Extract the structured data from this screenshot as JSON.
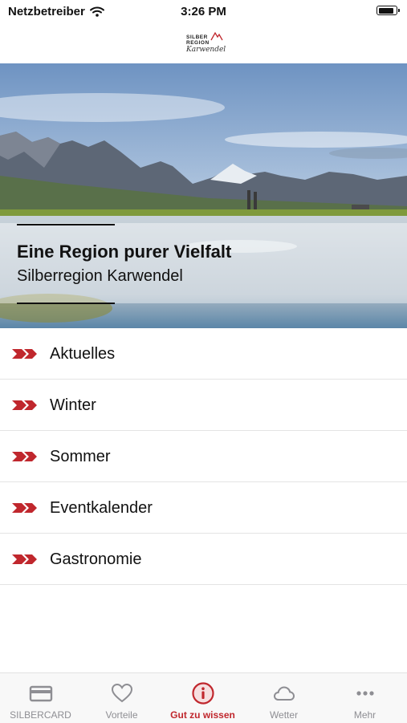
{
  "status_bar": {
    "carrier": "Netzbetreiber",
    "time": "3:26 PM",
    "battery_level": 0.9
  },
  "header": {
    "logo_line1": "SILBER",
    "logo_line2": "REGION",
    "logo_line3": "Karwendel"
  },
  "hero": {
    "title": "Eine Region purer Vielfalt",
    "subtitle": "Silberregion Karwendel"
  },
  "menu": {
    "items": [
      {
        "label": "Aktuelles"
      },
      {
        "label": "Winter"
      },
      {
        "label": "Sommer"
      },
      {
        "label": "Eventkalender"
      },
      {
        "label": "Gastronomie"
      }
    ]
  },
  "tabbar": {
    "active_color": "#c0272d",
    "inactive_color": "#8e8e93",
    "tabs": [
      {
        "label": "SILBERCARD",
        "icon": "card-icon"
      },
      {
        "label": "Vorteile",
        "icon": "heart-icon"
      },
      {
        "label": "Gut zu wissen",
        "icon": "info-icon",
        "active": true
      },
      {
        "label": "Wetter",
        "icon": "cloud-icon"
      },
      {
        "label": "Mehr",
        "icon": "more-icon"
      }
    ]
  },
  "colors": {
    "accent": "#c0272d"
  }
}
